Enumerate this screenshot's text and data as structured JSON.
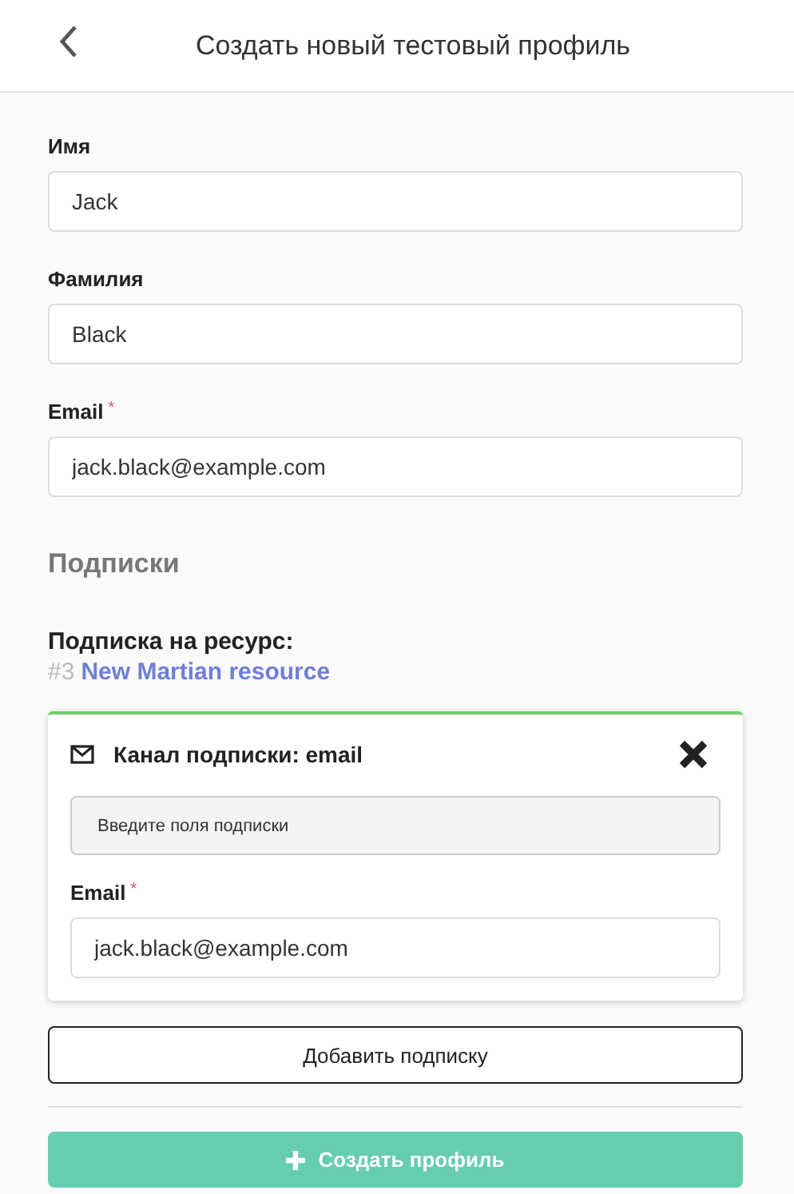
{
  "header": {
    "title": "Создать новый тестовый профиль"
  },
  "fields": [
    {
      "label": "Имя",
      "value": "Jack"
    },
    {
      "label": "Фамилия",
      "value": "Black"
    },
    {
      "label": "Email",
      "required_mark": "*",
      "value": "jack.black@example.com"
    }
  ],
  "subscriptions": {
    "heading": "Подписки",
    "resource_label": "Подписка на ресурс:",
    "resource_number": "#3",
    "resource_name": "New Martian resource",
    "channel": {
      "title": "Канал подписки: email",
      "hint": "Введите поля подписки",
      "fields": [
        {
          "label": "Email",
          "required_mark": "*",
          "value": "jack.black@example.com"
        }
      ]
    },
    "add_button": "Добавить подписку"
  },
  "submit": {
    "label": "Создать профиль",
    "disabled": true
  }
}
